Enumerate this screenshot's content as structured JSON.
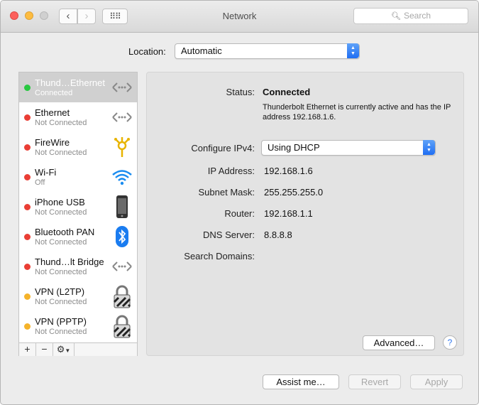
{
  "window": {
    "title": "Network"
  },
  "toolbar": {
    "back_icon": "chevron-left",
    "forward_icon": "chevron-right",
    "grid_icon": "show-all-grid",
    "search_placeholder": "Search"
  },
  "location": {
    "label": "Location:",
    "value": "Automatic"
  },
  "services": [
    {
      "name": "Thund…Ethernet",
      "status": "Connected",
      "status_color": "#28c840",
      "icon": "ethernet-arrows-icon",
      "selected": true
    },
    {
      "name": "Ethernet",
      "status": "Not Connected",
      "status_color": "#ea3e35",
      "icon": "ethernet-arrows-icon"
    },
    {
      "name": "FireWire",
      "status": "Not Connected",
      "status_color": "#ea3e35",
      "icon": "firewire-icon"
    },
    {
      "name": "Wi-Fi",
      "status": "Off",
      "status_color": "#ea3e35",
      "icon": "wifi-icon"
    },
    {
      "name": "iPhone USB",
      "status": "Not Connected",
      "status_color": "#ea3e35",
      "icon": "iphone-icon"
    },
    {
      "name": "Bluetooth PAN",
      "status": "Not Connected",
      "status_color": "#ea3e35",
      "icon": "bluetooth-icon"
    },
    {
      "name": "Thund…lt Bridge",
      "status": "Not Connected",
      "status_color": "#ea3e35",
      "icon": "ethernet-arrows-icon"
    },
    {
      "name": "VPN (L2TP)",
      "status": "Not Connected",
      "status_color": "#f5b32a",
      "icon": "vpn-lock-icon"
    },
    {
      "name": "VPN (PPTP)",
      "status": "Not Connected",
      "status_color": "#f5b32a",
      "icon": "vpn-lock-icon"
    }
  ],
  "sidebar_footer": {
    "add": "+",
    "remove": "−",
    "gear": "⚙"
  },
  "detail": {
    "status_label": "Status:",
    "status_value": "Connected",
    "status_description": "Thunderbolt Ethernet is currently active and has the IP address 192.168.1.6.",
    "configure_label": "Configure IPv4:",
    "configure_value": "Using DHCP",
    "ip_label": "IP Address:",
    "ip_value": "192.168.1.6",
    "subnet_label": "Subnet Mask:",
    "subnet_value": "255.255.255.0",
    "router_label": "Router:",
    "router_value": "192.168.1.1",
    "dns_label": "DNS Server:",
    "dns_value": "8.8.8.8",
    "search_domains_label": "Search Domains:",
    "advanced_label": "Advanced…",
    "help_label": "?"
  },
  "footer": {
    "assist_label": "Assist me…",
    "revert_label": "Revert",
    "apply_label": "Apply"
  }
}
